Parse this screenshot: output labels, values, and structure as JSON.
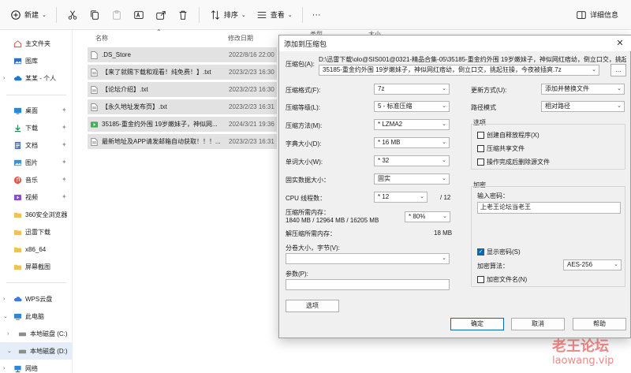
{
  "toolbar": {
    "new_label": "新建",
    "sort_label": "排序",
    "view_label": "查看",
    "more_label": "···",
    "details_label": "详细信息"
  },
  "nav": {
    "items": [
      {
        "label": "主文件夹",
        "icon": "home-icon"
      },
      {
        "label": "图库",
        "icon": "gallery-icon"
      },
      {
        "label": "某某 - 个人",
        "icon": "cloud-icon"
      },
      {
        "label": "桌面",
        "icon": "desktop-icon",
        "pinned": true
      },
      {
        "label": "下载",
        "icon": "download-icon",
        "pinned": true
      },
      {
        "label": "文档",
        "icon": "documents-icon",
        "pinned": true
      },
      {
        "label": "图片",
        "icon": "pictures-icon",
        "pinned": true
      },
      {
        "label": "音乐",
        "icon": "music-icon",
        "pinned": true
      },
      {
        "label": "视频",
        "icon": "videos-icon",
        "pinned": true
      },
      {
        "label": "360安全浏览器",
        "icon": "folder-icon"
      },
      {
        "label": "迅雷下载",
        "icon": "folder-icon"
      },
      {
        "label": "x86_64",
        "icon": "folder-icon"
      },
      {
        "label": "屏幕截图",
        "icon": "folder-icon"
      },
      {
        "label": "WPS云盘",
        "icon": "wps-cloud-icon"
      },
      {
        "label": "此电脑",
        "icon": "this-pc-icon"
      },
      {
        "label": "本地磁盘 (C:)",
        "icon": "drive-icon"
      },
      {
        "label": "本地磁盘 (D:)",
        "icon": "drive-icon"
      },
      {
        "label": "网络",
        "icon": "network-icon"
      }
    ]
  },
  "list": {
    "col_name": "名称",
    "col_date": "修改日期",
    "col_type": "类型",
    "col_size": "大小",
    "files": [
      {
        "name": ".DS_Store",
        "date": "2022/8/16 22:00"
      },
      {
        "name": "【来了就赐下载和观看！纯免费！】.txt",
        "date": "2023/2/23 16:30"
      },
      {
        "name": "【论坛介绍】.txt",
        "date": "2023/2/23 16:30"
      },
      {
        "name": "【永久地址发布页】.txt",
        "date": "2023/2/23 16:31"
      },
      {
        "name": "35185-重金约外围 19岁嫩妹子，神似网...",
        "date": "2024/3/21 19:36"
      },
      {
        "name": "最新地址及APP请发邮箱自动获取！！！...",
        "date": "2023/2/23 16:31"
      }
    ]
  },
  "dialog": {
    "title": "添加到压缩包",
    "archive_label": "压缩包(A):",
    "archive_path_line1": "D:\\迅雷下载\\olo@SIS001@0321-精品合集-05\\35185-重金约外围 19岁嫩妹子，神似网红痞幼，倒立口交，挑起狂",
    "archive_path_line2": "35185-重金约外围 19岁嫩妹子，神似网红痞幼，倒立口交，挑起狂操，今夜被插爽.7z",
    "browse_label": "...",
    "format_label": "压缩格式(F):",
    "format_value": "7z",
    "level_label": "压缩等级(L):",
    "level_value": "5 - 标准压缩",
    "method_label": "压缩方法(M):",
    "method_value": "* LZMA2",
    "dict_label": "字典大小(D):",
    "dict_value": "* 16 MB",
    "word_label": "单词大小(W):",
    "word_value": "* 32",
    "solid_label": "固实数据大小：",
    "solid_value": "固实",
    "threads_label": "CPU 线程数：",
    "threads_value": "* 12",
    "threads_total": "/ 12",
    "mem_comp_label": "压缩所需内存：",
    "mem_comp_value": "1840 MB / 12964 MB / 16205 MB",
    "mem_comp_pct": "* 80%",
    "mem_decomp_label": "解压缩所需内存：",
    "mem_decomp_value": "18 MB",
    "split_label": "分卷大小，字节(V):",
    "params_label": "参数(P):",
    "options_button": "选项",
    "update_label": "更新方式(U):",
    "update_value": "添加并替换文件",
    "path_label": "路径模式",
    "path_value": "相对路径",
    "options_group": "选项",
    "opt_sfx": "创建自释放程序(X)",
    "opt_shared": "压缩共享文件",
    "opt_delete": "操作完成后删除源文件",
    "encrypt_group": "加密",
    "password_label": "输入密码：",
    "password_value": "上老王论坛当老王",
    "show_password": "显示密码(S)",
    "enc_method_label": "加密算法：",
    "enc_method_value": "AES-256",
    "enc_names": "加密文件名(N)",
    "ok": "确定",
    "cancel": "取消",
    "help": "帮助"
  },
  "watermark": {
    "line1": "老王论坛",
    "line2": "laowang.vip"
  }
}
